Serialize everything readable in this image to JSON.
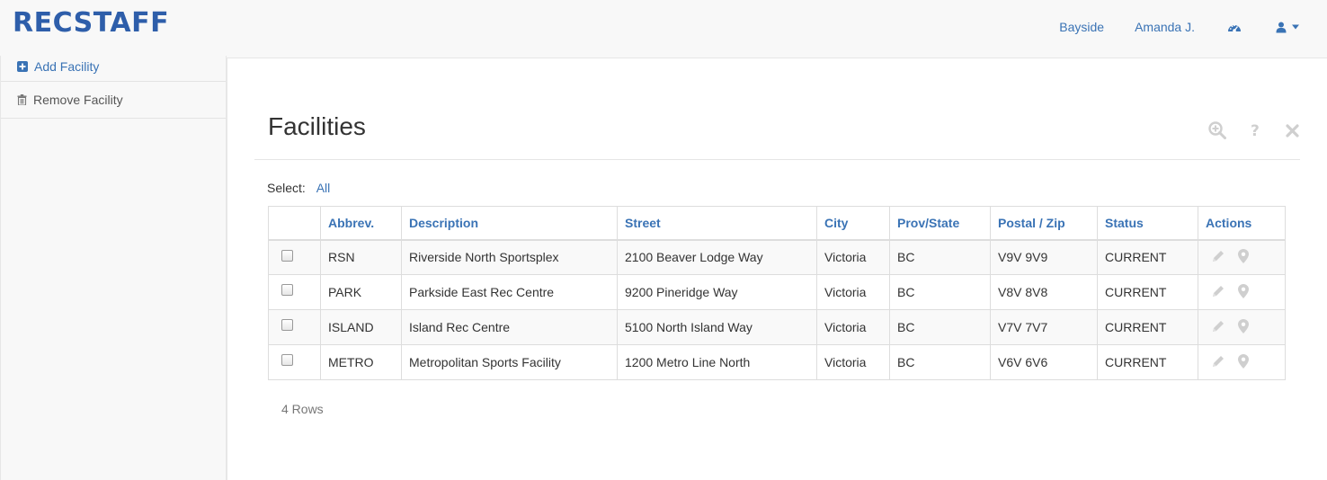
{
  "brand": "RECSTAFF",
  "nav": {
    "location": "Bayside",
    "user": "Amanda J.",
    "dashboard_icon": "dashboard-icon",
    "user_menu_icon": "user-icon"
  },
  "sidebar": {
    "items": [
      {
        "label": "Add Facility",
        "icon": "plus-square-icon"
      },
      {
        "label": "Remove Facility",
        "icon": "trash-icon"
      }
    ]
  },
  "page": {
    "title": "Facilities",
    "tools": [
      "zoom-in-icon",
      "question-icon",
      "close-icon"
    ]
  },
  "select": {
    "label": "Select:",
    "all": "All"
  },
  "table": {
    "columns": [
      "Abbrev.",
      "Description",
      "Street",
      "City",
      "Prov/State",
      "Postal / Zip",
      "Status",
      "Actions"
    ],
    "rows": [
      {
        "abbrev": "RSN",
        "description": "Riverside North Sportsplex",
        "street": "2100 Beaver Lodge Way",
        "city": "Victoria",
        "prov": "BC",
        "postal": "V9V 9V9",
        "status": "CURRENT"
      },
      {
        "abbrev": "PARK",
        "description": "Parkside East Rec Centre",
        "street": "9200 Pineridge Way",
        "city": "Victoria",
        "prov": "BC",
        "postal": "V8V 8V8",
        "status": "CURRENT"
      },
      {
        "abbrev": "ISLAND",
        "description": "Island Rec Centre",
        "street": "5100 North Island Way",
        "city": "Victoria",
        "prov": "BC",
        "postal": "V7V 7V7",
        "status": "CURRENT"
      },
      {
        "abbrev": "METRO",
        "description": "Metropolitan Sports Facility",
        "street": "1200 Metro Line North",
        "city": "Victoria",
        "prov": "BC",
        "postal": "V6V 6V6",
        "status": "CURRENT"
      }
    ]
  },
  "footer": {
    "row_count": "4 Rows"
  },
  "colors": {
    "accent": "#3a73b5",
    "brand": "#2e5eaa",
    "muted_icon": "#c8c8c8"
  }
}
